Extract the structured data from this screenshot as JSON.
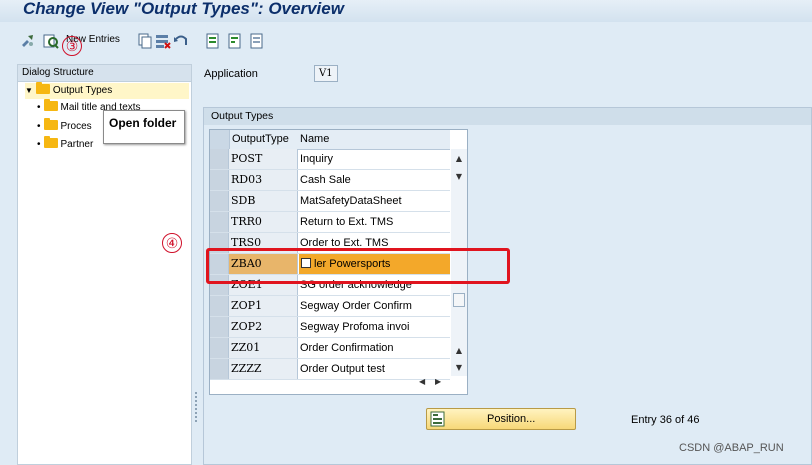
{
  "window": {
    "title": "Change View \"Output Types\": Overview"
  },
  "toolbar": {
    "new_entries_label": "New Entries",
    "icons": [
      "display-change-icon",
      "other-view-icon",
      "copy-icon",
      "delete-icon",
      "undo-icon",
      "select-all-icon",
      "select-block-icon",
      "deselect-all-icon"
    ]
  },
  "annotations": {
    "callout_3": "③",
    "callout_4": "④"
  },
  "dialog_structure": {
    "header": "Dialog Structure",
    "items": [
      {
        "label": "Output Types",
        "selected": true,
        "expanded": true
      },
      {
        "label": "Mail title and texts"
      },
      {
        "label": "Proces"
      },
      {
        "label": "Partner"
      }
    ],
    "tooltip": "Open folder"
  },
  "application": {
    "label": "Application",
    "value": "V1"
  },
  "output_types": {
    "group_title": "Output Types",
    "columns": [
      "OutputType",
      "Name"
    ],
    "rows": [
      {
        "code": "POST",
        "name": "Inquiry"
      },
      {
        "code": "RD03",
        "name": "Cash Sale"
      },
      {
        "code": "SDB",
        "name": "MatSafetyDataSheet"
      },
      {
        "code": "TRR0",
        "name": "Return to Ext. TMS"
      },
      {
        "code": "TRS0",
        "name": "Order to Ext. TMS"
      },
      {
        "code": "ZBA0",
        "name": "ler Powersports",
        "highlighted": true
      },
      {
        "code": "ZOE1",
        "name": "SG order acknowledge"
      },
      {
        "code": "ZOP1",
        "name": "Segway Order Confirm"
      },
      {
        "code": "ZOP2",
        "name": "Segway Profoma invoi"
      },
      {
        "code": "ZZ01",
        "name": "Order Confirmation"
      },
      {
        "code": "ZZZZ",
        "name": "Order Output test"
      }
    ]
  },
  "position_button": {
    "label": "Position..."
  },
  "entry_status": "Entry 36 of 46",
  "watermark": "CSDN @ABAP_RUN",
  "colors": {
    "title": "#0c2f6b",
    "highlight": "#f3a82a",
    "red_box": "#e0141e",
    "folder": "#f6b712"
  }
}
